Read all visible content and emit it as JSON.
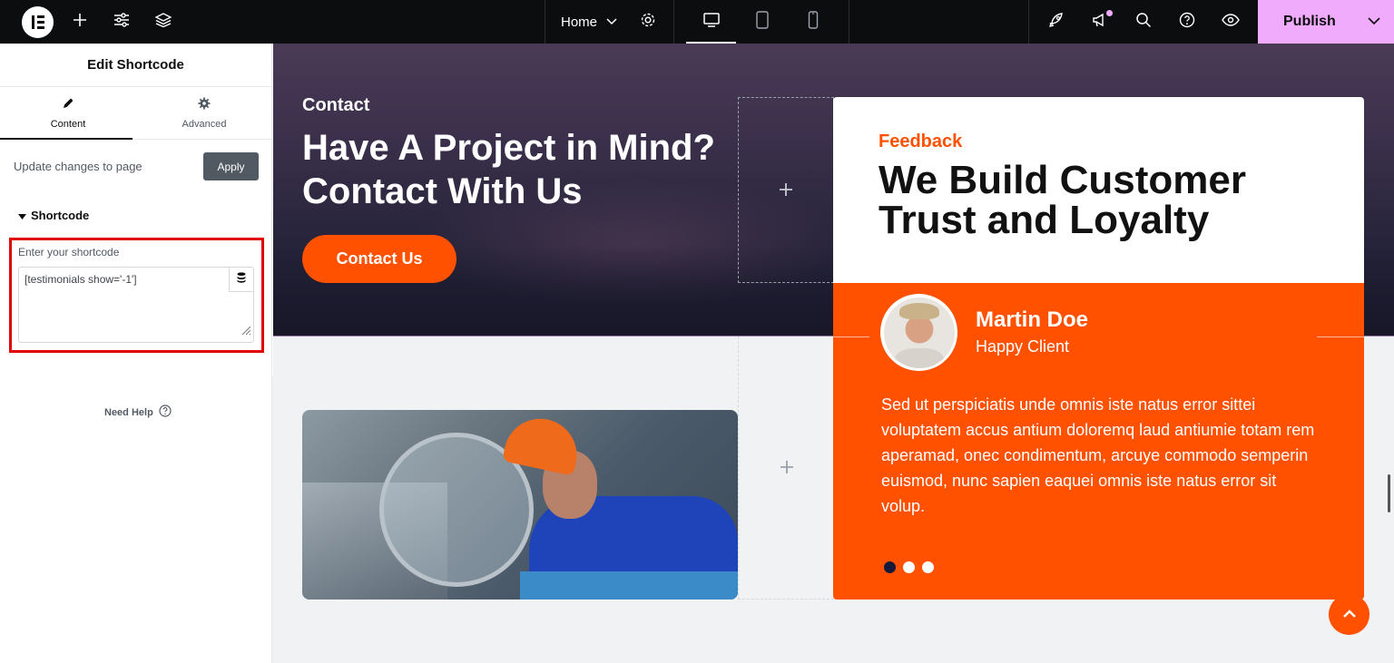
{
  "topbar": {
    "page_name": "Home",
    "publish_label": "Publish",
    "icons": [
      "elementor-logo-icon",
      "plus-icon",
      "sliders-icon",
      "layers-icon",
      "chevron-down-icon",
      "gear-icon",
      "desktop-icon",
      "tablet-icon",
      "mobile-icon",
      "rocket-icon",
      "megaphone-icon",
      "search-icon",
      "help-icon",
      "eye-icon"
    ]
  },
  "panel": {
    "title": "Edit Shortcode",
    "tabs": [
      {
        "label": "Content",
        "icon": "pencil-icon",
        "active": true
      },
      {
        "label": "Advanced",
        "icon": "gear-icon",
        "active": false
      }
    ],
    "update_text": "Update changes to page",
    "apply_label": "Apply",
    "section_title": "Shortcode",
    "shortcode_label": "Enter your shortcode",
    "shortcode_value": "[testimonials show='-1']",
    "help_label": "Need Help"
  },
  "hero": {
    "eyebrow": "Contact",
    "title": "Have A Project in Mind? Contact With Us",
    "button_label": "Contact Us"
  },
  "testimonial": {
    "eyebrow": "Feedback",
    "title": "We Build Customer Trust and Loyalty",
    "name": "Martin Doe",
    "role": "Happy Client",
    "quote": "Sed ut perspiciatis unde omnis iste natus error sittei voluptatem accus antium doloremq laud antiumie totam rem aperamad, onec condimentum, arcuye commodo semperin euismod, nunc sapien eaquei omnis iste natus error sit volup.",
    "slides": 3,
    "active_slide": 1
  },
  "colors": {
    "accent": "#ff5100",
    "publish": "#f0abfc",
    "topbar": "#0c0d0e",
    "highlight": "#e00000"
  }
}
